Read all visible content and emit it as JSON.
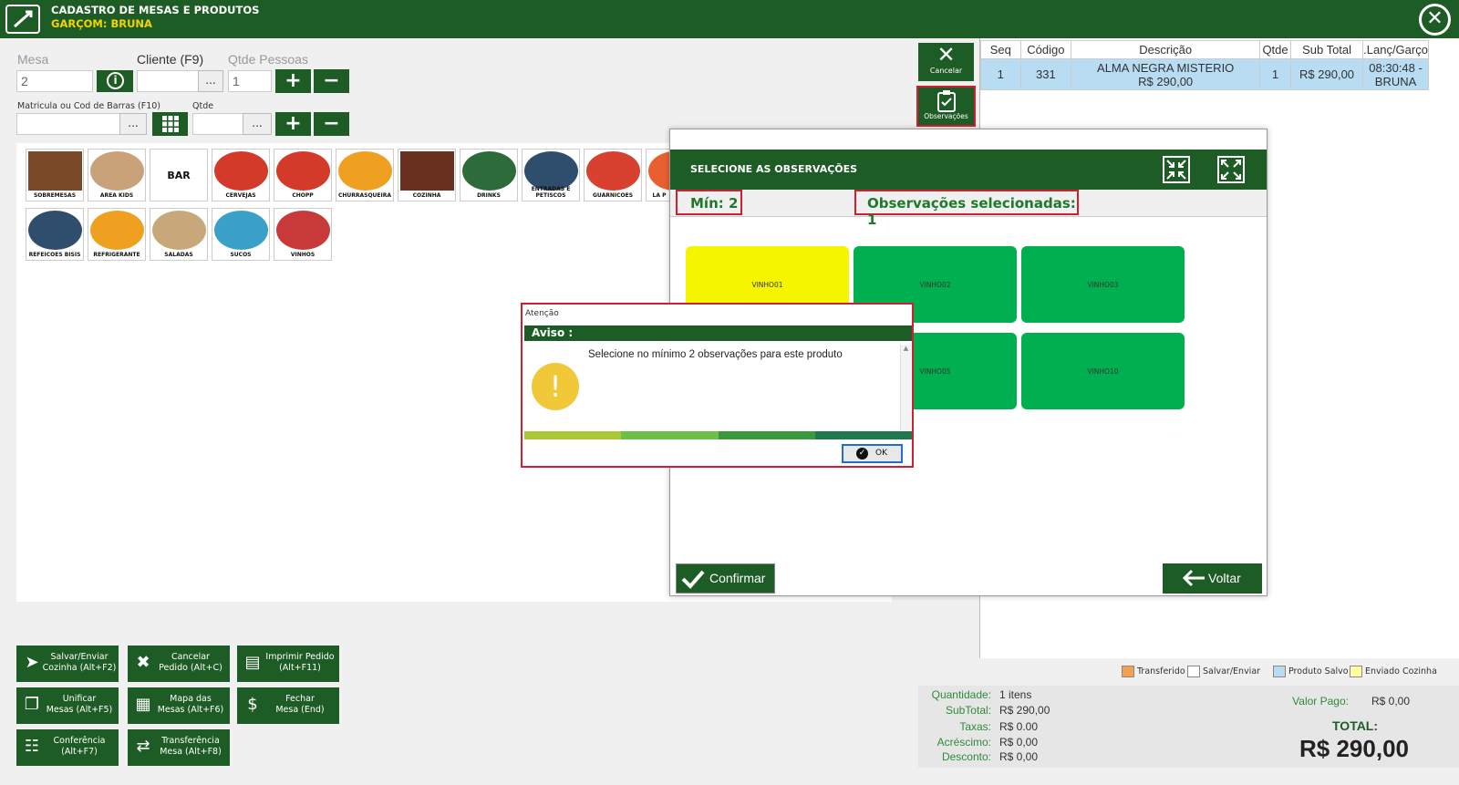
{
  "window": {
    "title": "CADASTRO DE MESAS E PRODUTOS",
    "waiter": "GARÇOM: BRUNA"
  },
  "form": {
    "mesa_label": "Mesa",
    "mesa_value": "2",
    "cliente_label": "Cliente (F9)",
    "cliente_value": "",
    "pessoas_label": "Qtde Pessoas",
    "pessoas_value": "1",
    "matricula_label": "Matricula ou Cod de Barras (F10)",
    "matricula_value": "",
    "qtde_label": "Qtde",
    "qtde_value": "",
    "dots": "...",
    "plus": "+",
    "minus": "−"
  },
  "categories": [
    {
      "name": "SOBREMESAS",
      "color": "#7a4a28"
    },
    {
      "name": "AREA KIDS",
      "color": "#c9a27a"
    },
    {
      "name": "BAR",
      "color": "#ffffff"
    },
    {
      "name": "CERVEJAS",
      "color": "#d33a2a"
    },
    {
      "name": "CHOPP",
      "color": "#d33a2a"
    },
    {
      "name": "CHURRASQUEIRA",
      "color": "#f0a020"
    },
    {
      "name": "COZINHA",
      "color": "#6a3020"
    },
    {
      "name": "DRINKS",
      "color": "#2e6b3a"
    },
    {
      "name": "ENTRADAS E PETISCOS",
      "color": "#2f4e6e"
    },
    {
      "name": "GUARNICOES",
      "color": "#d84030"
    },
    {
      "name": "LA P",
      "color": "#e86030"
    },
    {
      "name": "REFEICOES BISIS",
      "color": "#2f4e6e"
    },
    {
      "name": "REFRIGERANTE",
      "color": "#f0a020"
    },
    {
      "name": "SALADAS",
      "color": "#c8a87a"
    },
    {
      "name": "SUCOS",
      "color": "#3aa0c8"
    },
    {
      "name": "VINHOS",
      "color": "#c83a3a"
    }
  ],
  "actions": [
    {
      "label": "Salvar/Enviar\nCozinha (Alt+F2)",
      "icon": "paper-plane-icon",
      "glyph": "➤"
    },
    {
      "label": "Cancelar\nPedido (Alt+C)",
      "icon": "cancel-chat-icon",
      "glyph": "✖"
    },
    {
      "label": "Imprimir Pedido\n(Alt+F11)",
      "icon": "printer-icon",
      "glyph": "▤"
    },
    {
      "label": "Unificar\nMesas (Alt+F5)",
      "icon": "merge-icon",
      "glyph": "❐"
    },
    {
      "label": "Mapa das\nMesas (Alt+F6)",
      "icon": "grid-icon",
      "glyph": "▦"
    },
    {
      "label": "Fechar\nMesa (End)",
      "icon": "money-hand-icon",
      "glyph": "$"
    },
    {
      "label": "Conferência\n(Alt+F7)",
      "icon": "clipboard-icon",
      "glyph": "☷"
    },
    {
      "label": "Transferência\nMesa (Alt+F8)",
      "icon": "transfer-icon",
      "glyph": "⇄"
    }
  ],
  "side_buttons": {
    "cancel": "Cancelar",
    "observations": "Observações"
  },
  "order_table": {
    "headers": [
      "Seq",
      "Código",
      "Descrição",
      "Qtde",
      "Sub Total",
      ".Lanç/Garço"
    ],
    "rows": [
      {
        "seq": "1",
        "code": "331",
        "desc": "ALMA NEGRA MISTERIO",
        "desc2": "R$ 290,00",
        "qty": "1",
        "subtotal": "R$ 290,00",
        "time": "08:30:48 -",
        "waiter": "BRUNA"
      }
    ]
  },
  "legend": {
    "items": [
      {
        "label": "Transferido",
        "color": "#f5a050"
      },
      {
        "label": "Salvar/Enviar",
        "color": "#ffffff"
      },
      {
        "label": "Produto Salvo",
        "color": "#b8dcf2"
      },
      {
        "label": "Enviado Cozinha",
        "color": "#ffffa0"
      }
    ]
  },
  "totals": {
    "quantidade_label": "Quantidade:",
    "quantidade": "1 itens",
    "subtotal_label": "SubTotal:",
    "subtotal": "R$ 290,00",
    "taxas_label": "Taxas:",
    "taxas": "R$ 0.00",
    "acrescimo_label": "Acréscimo:",
    "acrescimo": "R$ 0,00",
    "desconto_label": "Desconto:",
    "desconto": "R$ 0,00",
    "valor_pago_label": "Valor Pago:",
    "valor_pago": "R$ 0,00",
    "total_label": "TOTAL:",
    "total": "R$ 290,00"
  },
  "obs_dialog": {
    "title": "SELECIONE AS OBSERVAÇÕES",
    "min": "Mín: 2",
    "selected": "Observações selecionadas: 1",
    "tiles": [
      {
        "label": "VINHO01",
        "color": "#f5f500"
      },
      {
        "label": "VINHO02",
        "color": "#00b050"
      },
      {
        "label": "VINHO03",
        "color": "#00b050"
      },
      {
        "label": "",
        "color": "#00b050"
      },
      {
        "label": "VINHO05",
        "color": "#00b050"
      },
      {
        "label": "VINHO10",
        "color": "#00b050"
      }
    ],
    "confirm": "Confirmar",
    "back": "Voltar"
  },
  "alert": {
    "window_title": "Atenção",
    "header": "Aviso :",
    "message": "Selecione no mínimo 2 observações para este produto",
    "ok": "OK",
    "progress_colors": [
      "#a8c838",
      "#6cbf4a",
      "#3a9a3a",
      "#1e7a4a"
    ]
  }
}
